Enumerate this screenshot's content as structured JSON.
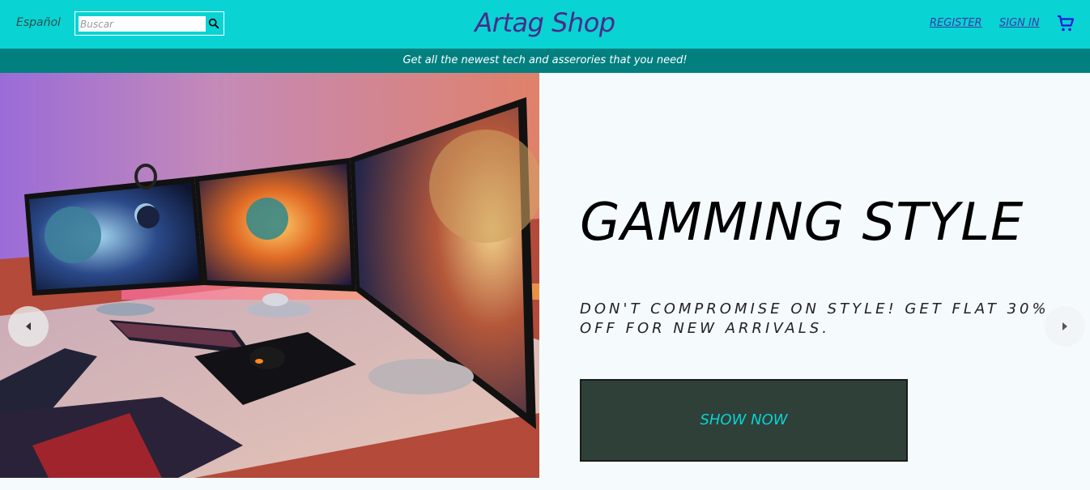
{
  "header": {
    "language_label": "Español",
    "search_placeholder": "Buscar",
    "brand": "Artag Shop",
    "register_label": "REGISTER",
    "signin_label": "SIGN IN",
    "cart_icon": "cart-icon",
    "search_icon": "search-icon"
  },
  "promo": {
    "text": "Get all the newest tech and asserories that you need!"
  },
  "hero": {
    "title": "GAMMING STYLE",
    "subtitle": "DON'T COMPROMISE ON STYLE! GET FLAT 30% OFF FOR NEW ARRIVALS.",
    "button_label": "SHOW NOW",
    "prev_icon": "chevron-left-icon",
    "next_icon": "chevron-right-icon"
  },
  "colors": {
    "navbar": "#0ad3d3",
    "promo_bar": "#028080",
    "brand_text": "#4a2a8c",
    "button_bg": "#2e4038",
    "button_text": "#0ad3d3"
  }
}
